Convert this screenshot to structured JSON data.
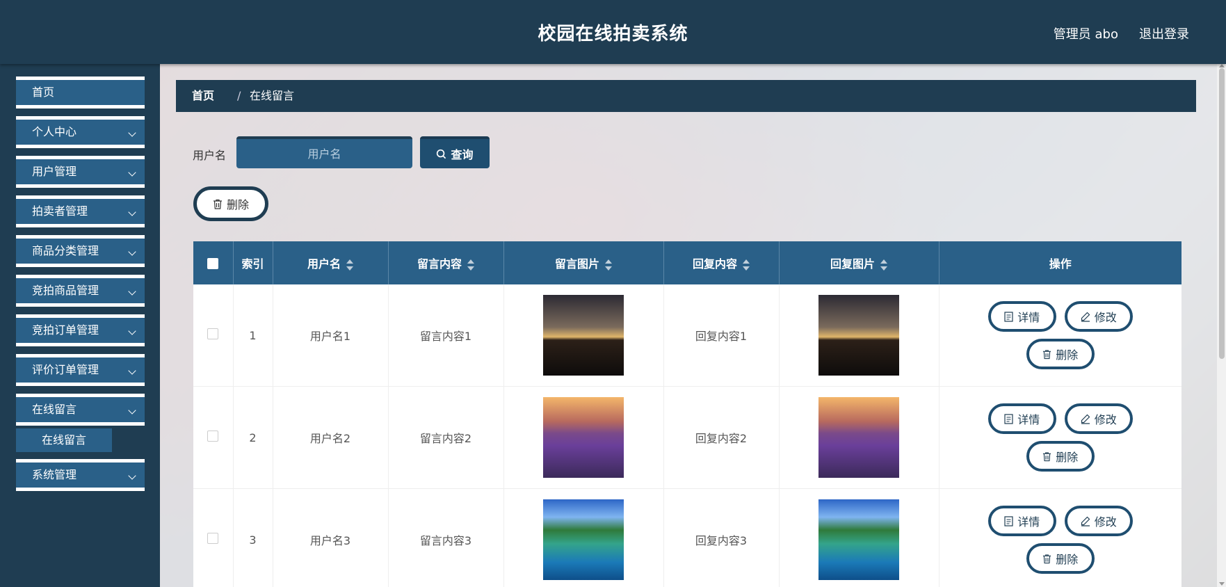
{
  "header": {
    "title": "校园在线拍卖系统",
    "user": "管理员 abo",
    "logout": "退出登录"
  },
  "sidebar": {
    "items": [
      {
        "label": "首页",
        "expandable": false
      },
      {
        "label": "个人中心",
        "expandable": true
      },
      {
        "label": "用户管理",
        "expandable": true
      },
      {
        "label": "拍卖者管理",
        "expandable": true
      },
      {
        "label": "商品分类管理",
        "expandable": true
      },
      {
        "label": "竞拍商品管理",
        "expandable": true
      },
      {
        "label": "竞拍订单管理",
        "expandable": true
      },
      {
        "label": "评价订单管理",
        "expandable": true
      },
      {
        "label": "在线留言",
        "expandable": true
      },
      {
        "label": "系统管理",
        "expandable": true
      }
    ],
    "submenu": {
      "label": "在线留言"
    }
  },
  "breadcrumb": {
    "home": "首页",
    "separator": "/",
    "current": "在线留言"
  },
  "search": {
    "label": "用户名",
    "placeholder": "用户名",
    "button": "查询"
  },
  "bulk_delete": "删除",
  "table": {
    "columns": [
      "索引",
      "用户名",
      "留言内容",
      "留言图片",
      "回复内容",
      "回复图片",
      "操作"
    ],
    "rows": [
      {
        "index": "1",
        "username": "用户名1",
        "message": "留言内容1",
        "image": "landscape-tree-lake",
        "reply": "回复内容1",
        "reply_image": "landscape-tree-lake"
      },
      {
        "index": "2",
        "username": "用户名2",
        "message": "留言内容2",
        "image": "lavender-field-sunset",
        "reply": "回复内容2",
        "reply_image": "lavender-field-sunset"
      },
      {
        "index": "3",
        "username": "用户名3",
        "message": "留言内容3",
        "image": "tropical-island-sea",
        "reply": "回复内容3",
        "reply_image": "tropical-island-sea"
      }
    ],
    "actions": {
      "detail": "详情",
      "edit": "修改",
      "delete": "删除"
    }
  },
  "colors": {
    "header_bg": "#1f3d52",
    "menu_bg": "#2a6088",
    "table_header": "#2a6088",
    "button_border": "#1f4e70"
  }
}
